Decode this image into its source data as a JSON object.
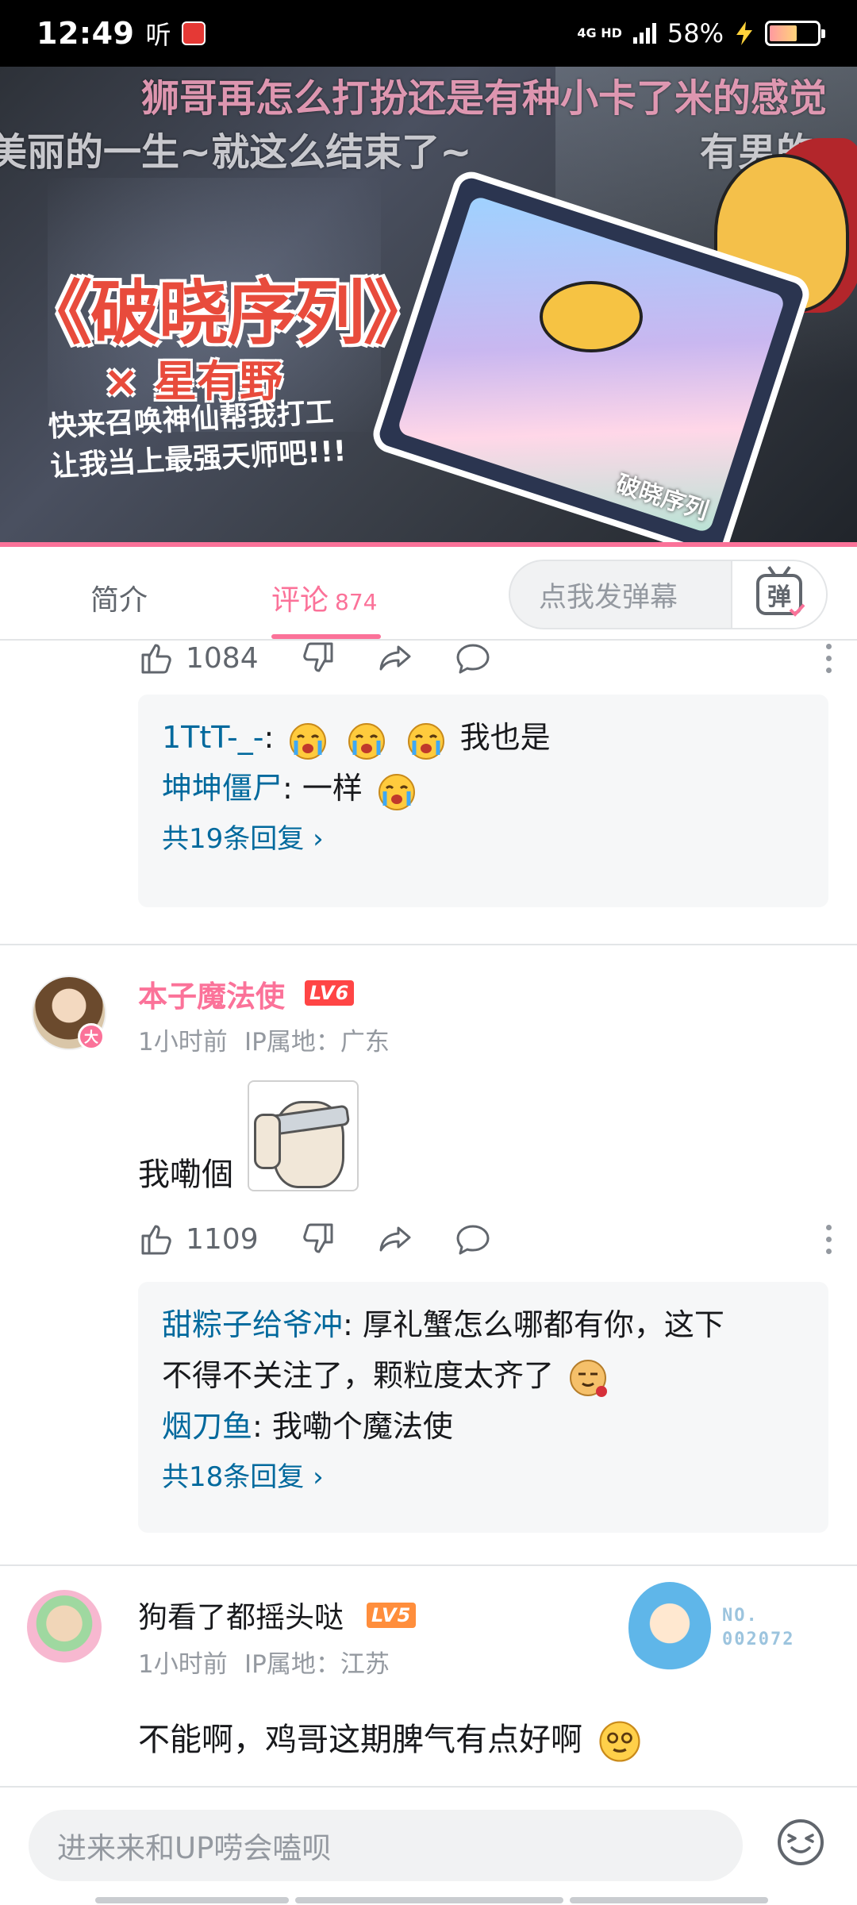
{
  "status_bar": {
    "time": "12:49",
    "ting": "听",
    "network": "4G HD",
    "battery": "58%"
  },
  "video": {
    "danmaku": [
      "狮哥再怎么打扮还是有种小卡了米的感觉",
      "美丽的一生~就这么结束了~",
      "有男的，"
    ],
    "title": "《破晓序列》",
    "subtitle": "× 星有野",
    "caption_line1": "快来召唤神仙帮我打工",
    "caption_line2": "让我当上最强天师吧!!!",
    "phone_label": "破晓序列",
    "progress": 0.0
  },
  "tabs": {
    "intro": "简介",
    "comments": "评论",
    "comments_count": "874",
    "danmaku_placeholder": "点我发弹幕",
    "danmaku_icon_label": "弹"
  },
  "comments": [
    {
      "likes": "1084",
      "replies": [
        {
          "user": "1TtT-_-",
          "text": "我也是"
        },
        {
          "user": "坤坤僵尸",
          "text": "一样"
        }
      ],
      "more_replies": "共19条回复 ›"
    },
    {
      "user": "本子魔法使",
      "level": "LV6",
      "avatar_badge": "大",
      "time": "1小时前",
      "ip": "IP属地：广东",
      "content": "我嘞個",
      "likes": "1109",
      "replies": [
        {
          "user": "甜粽子给爷冲",
          "text": "厚礼蟹怎么哪都有你，这下",
          "text2": "不得不关注了，颗粒度太齐了"
        },
        {
          "user": "烟刀鱼",
          "text": "我嘞个魔法使"
        }
      ],
      "more_replies": "共18条回复 ›"
    },
    {
      "user": "狗看了都摇头哒",
      "level": "LV5",
      "time": "1小时前",
      "ip": "IP属地：江苏",
      "content": "不能啊，鸡哥这期脾气有点好啊",
      "fan_no_label": "NO.",
      "fan_no_value": "002072"
    }
  ],
  "bottom": {
    "placeholder": "进来来和UP唠会嗑呗"
  },
  "colors": {
    "accent": "#fb7299",
    "link": "#00699d",
    "muted": "#9499a0"
  }
}
